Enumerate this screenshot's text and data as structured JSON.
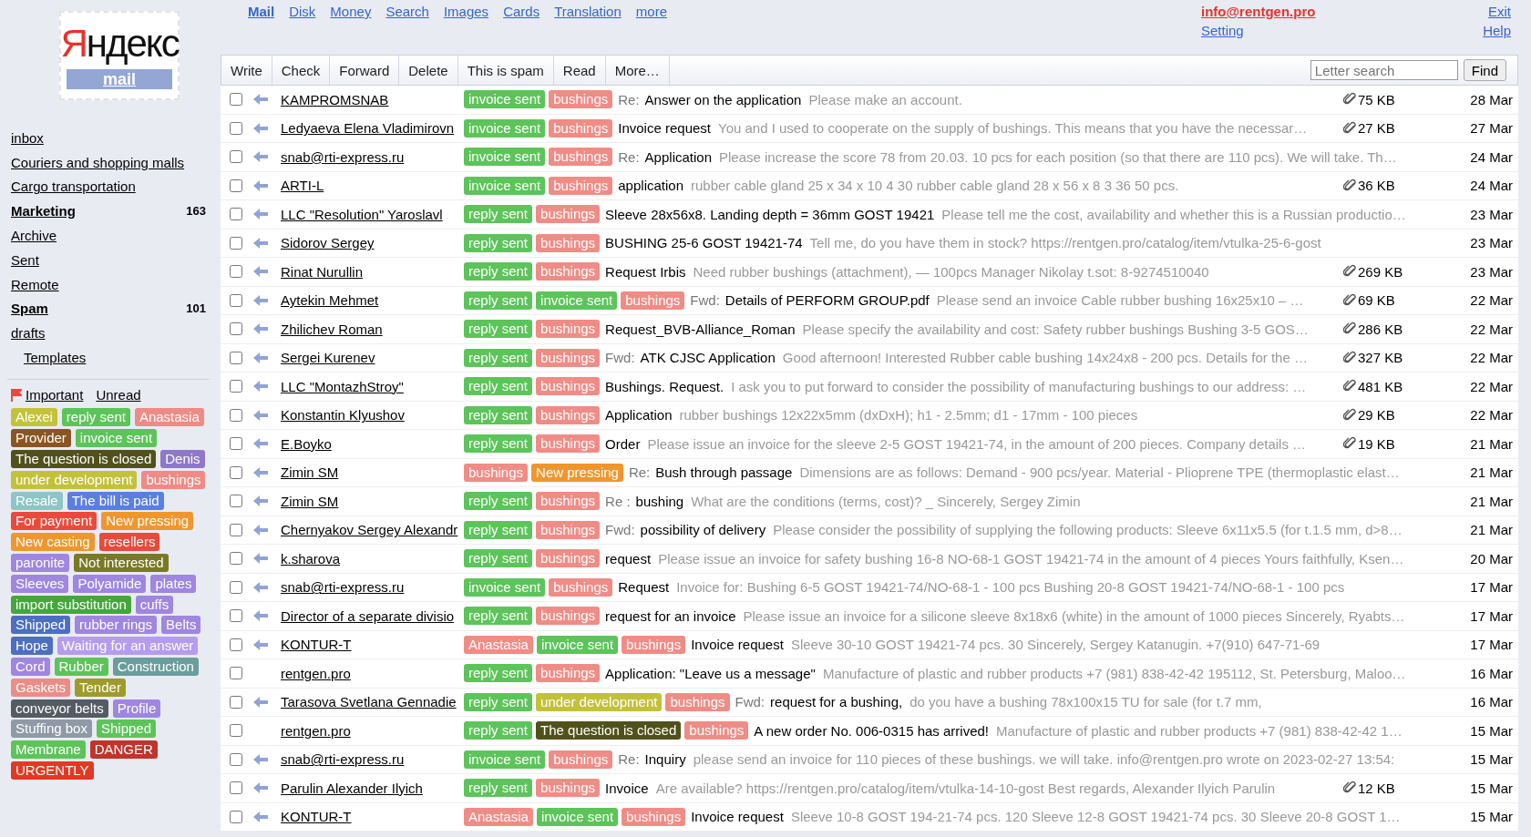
{
  "logo": {
    "wordmark": "Яндекс",
    "product": "mail"
  },
  "nav": [
    {
      "label": "Mail",
      "selected": true
    },
    {
      "label": "Disk",
      "selected": false
    },
    {
      "label": "Money",
      "selected": false
    },
    {
      "label": "Search",
      "selected": false
    },
    {
      "label": "Images",
      "selected": false
    },
    {
      "label": "Cards",
      "selected": false
    },
    {
      "label": "Translation",
      "selected": false
    },
    {
      "label": "more",
      "selected": false
    }
  ],
  "account": {
    "email": "info@rentgen.pro",
    "setting": "Setting",
    "exit": "Exit",
    "help": "Help"
  },
  "folders": [
    {
      "name": "inbox",
      "unread": false
    },
    {
      "name": "Couriers and shopping malls",
      "unread": false
    },
    {
      "name": "Cargo transportation",
      "unread": false
    },
    {
      "name": "Marketing",
      "unread": true,
      "count": "163"
    },
    {
      "name": "Archive",
      "unread": false
    },
    {
      "name": "Sent",
      "unread": false
    },
    {
      "name": "Remote",
      "unread": false
    },
    {
      "name": "Spam",
      "unread": true,
      "count": "101"
    },
    {
      "name": "drafts",
      "unread": false,
      "children": [
        {
          "name": "Templates",
          "unread": false
        }
      ]
    }
  ],
  "filters": [
    "Important",
    "Unread"
  ],
  "label_rows": [
    [
      {
        "label": "Alexei",
        "color": "#c4c23a"
      },
      {
        "label": "reply sent",
        "color": "#5cc45a"
      },
      {
        "label": "Anastasia",
        "color": "#ee8b85"
      }
    ],
    [
      {
        "label": "Provider",
        "color": "#8a5523"
      },
      {
        "label": "invoice sent",
        "color": "#5cc45a"
      }
    ],
    [
      {
        "label": "The question is closed",
        "color": "#51521b"
      },
      {
        "label": "Denis",
        "color": "#8f78c8"
      }
    ],
    [
      {
        "label": "under development",
        "color": "#c3c13a"
      },
      {
        "label": "bushings",
        "color": "#ee8b85"
      }
    ],
    [
      {
        "label": "Resale",
        "color": "#8cc6c6"
      },
      {
        "label": "The bill is paid",
        "color": "#5a7fe0"
      }
    ],
    [
      {
        "label": "For payment",
        "color": "#e84a3c"
      },
      {
        "label": "New pressing",
        "color": "#f0962e"
      }
    ],
    [
      {
        "label": "New casting",
        "color": "#f0962e"
      },
      {
        "label": "resellers",
        "color": "#e84a3c"
      }
    ],
    [
      {
        "label": "paronite",
        "color": "#9f86e0"
      },
      {
        "label": "Not interested",
        "color": "#7a7a24"
      }
    ],
    [
      {
        "label": "Sleeves",
        "color": "#9f86e0"
      },
      {
        "label": "Polyamide",
        "color": "#9f86e0"
      },
      {
        "label": "plates",
        "color": "#9f86e0"
      }
    ],
    [
      {
        "label": "import substitution",
        "color": "#46a63e"
      },
      {
        "label": "cuffs",
        "color": "#9f86e0"
      }
    ],
    [
      {
        "label": "Shipped",
        "color": "#4c6fc2"
      },
      {
        "label": "rubber rings",
        "color": "#9f86e0"
      },
      {
        "label": "Belts",
        "color": "#9f86e0"
      }
    ],
    [
      {
        "label": "Hope",
        "color": "#4c6fc2"
      },
      {
        "label": "Waiting for an answer",
        "color": "#b59cf0"
      }
    ],
    [
      {
        "label": "Cord",
        "color": "#9f86e0"
      },
      {
        "label": "Rubber",
        "color": "#5cc45a"
      },
      {
        "label": "Construction",
        "color": "#6a9e9c"
      }
    ],
    [
      {
        "label": "Gaskets",
        "color": "#ee8b85"
      },
      {
        "label": "Tender",
        "color": "#9e9a2c"
      }
    ],
    [
      {
        "label": "conveyor belts",
        "color": "#555b62"
      },
      {
        "label": "Profile",
        "color": "#9f86e0"
      }
    ],
    [
      {
        "label": "Stuffing box",
        "color": "#8f9aa6"
      },
      {
        "label": "Shipped",
        "color": "#5cc45a"
      }
    ],
    [
      {
        "label": "Membrane",
        "color": "#5cc45a"
      },
      {
        "label": "DANGER",
        "color": "#c0342a"
      }
    ],
    [
      {
        "label": "URGENTLY",
        "color": "#e03a24"
      }
    ]
  ],
  "toolbar": {
    "buttons": [
      "Write",
      "Check",
      "Forward",
      "Delete",
      "This is spam",
      "Read",
      "More…"
    ],
    "search": {
      "placeholder": "Letter search"
    },
    "find": "Find"
  },
  "messages": [
    {
      "checked": false,
      "replied": true,
      "sender": "KAMPROMSNAB",
      "tags": [
        {
          "label": "invoice sent",
          "color": "#5cc45a"
        },
        {
          "label": "bushings",
          "color": "#f08c86"
        }
      ],
      "prefix": "Re:",
      "subject": "Answer on the application",
      "snippet": "Please make an account.",
      "attachment": "75 KB",
      "date": "28 Mar"
    },
    {
      "checked": false,
      "replied": true,
      "sender": "Ledyaeva Elena Vladimirovn",
      "tags": [
        {
          "label": "invoice sent",
          "color": "#5cc45a"
        },
        {
          "label": "bushings",
          "color": "#f08c86"
        }
      ],
      "subject": "Invoice request",
      "snippet": "You and I used to cooperate on the supply of bushings. This means that you have the necessar…",
      "attachment": "27 KB",
      "date": "27 Mar"
    },
    {
      "checked": false,
      "replied": true,
      "sender": "snab@rti-express.ru",
      "tags": [
        {
          "label": "invoice sent",
          "color": "#5cc45a"
        },
        {
          "label": "bushings",
          "color": "#f08c86"
        }
      ],
      "prefix": "Re:",
      "subject": "Application",
      "snippet": "Please increase the score 78 from 20.03. 10 pcs for each position (so that there are 110 pcs). We will take. Th…",
      "date": "24 Mar"
    },
    {
      "checked": false,
      "replied": true,
      "sender": "ARTI-L",
      "tags": [
        {
          "label": "invoice sent",
          "color": "#5cc45a"
        },
        {
          "label": "bushings",
          "color": "#f08c86"
        }
      ],
      "subject": "application",
      "snippet": "rubber cable gland 25 x 34 x 10 4 30 rubber cable gland 28 x 56 x 8 3 36 50 pcs.",
      "attachment": "36 KB",
      "date": "24 Mar"
    },
    {
      "checked": false,
      "replied": true,
      "sender": "LLC \"Resolution\" Yaroslavl",
      "tags": [
        {
          "label": "reply sent",
          "color": "#5cc45a"
        },
        {
          "label": "bushings",
          "color": "#f08c86"
        }
      ],
      "subject": "Sleeve 28x56x8. Landing depth = 36mm GOST 19421",
      "snippet": "Please tell me the cost, availability and whether this is a Russian productio…",
      "date": "23 Mar"
    },
    {
      "checked": false,
      "replied": true,
      "sender": "Sidorov Sergey",
      "tags": [
        {
          "label": "reply sent",
          "color": "#5cc45a"
        },
        {
          "label": "bushings",
          "color": "#f08c86"
        }
      ],
      "subject": "BUSHING 25-6 GOST 19421-74",
      "snippet": "Tell me, do you have them in stock? https://rentgen.pro/catalog/item/vtulka-25-6-gost",
      "date": "23 Mar"
    },
    {
      "checked": false,
      "replied": true,
      "sender": "Rinat Nurullin",
      "tags": [
        {
          "label": "reply sent",
          "color": "#5cc45a"
        },
        {
          "label": "bushings",
          "color": "#f08c86"
        }
      ],
      "subject": "Request Irbis",
      "snippet": "Need rubber bushings (attachment), — 100pcs Manager Nikolay t.sot: 8-9274510040",
      "attachment": "269 KB",
      "date": "23 Mar"
    },
    {
      "checked": false,
      "replied": true,
      "sender": "Aytekin Mehmet",
      "tags": [
        {
          "label": "reply sent",
          "color": "#5cc45a"
        },
        {
          "label": "invoice sent",
          "color": "#5cc45a"
        },
        {
          "label": "bushings",
          "color": "#f08c86"
        }
      ],
      "prefix": "Fwd:",
      "subject": "Details of PERFORM GROUP.pdf",
      "snippet": "Please send an invoice Cable rubber bushing 16x25x10 – …",
      "attachment": "69 KB",
      "date": "22 Mar"
    },
    {
      "checked": false,
      "replied": true,
      "sender": "Zhilichev Roman",
      "tags": [
        {
          "label": "reply sent",
          "color": "#5cc45a"
        },
        {
          "label": "bushings",
          "color": "#f08c86"
        }
      ],
      "subject": "Request_BVB-Alliance_Roman",
      "snippet": "Please specify the availability and cost: Safety rubber bushings Bushing 3-5 GOS…",
      "attachment": "286 KB",
      "date": "22 Mar"
    },
    {
      "checked": false,
      "replied": true,
      "sender": "Sergei Kurenev",
      "tags": [
        {
          "label": "reply sent",
          "color": "#5cc45a"
        },
        {
          "label": "bushings",
          "color": "#f08c86"
        }
      ],
      "prefix": "Fwd:",
      "subject": "ATK CJSC Application",
      "snippet": "Good afternoon! Interested Rubber cable bushing 14x24x8 - 200 pcs. Details for the …",
      "attachment": "327 KB",
      "date": "22 Mar"
    },
    {
      "checked": false,
      "replied": true,
      "sender": "LLC \"MontazhStroy\"",
      "tags": [
        {
          "label": "reply sent",
          "color": "#5cc45a"
        },
        {
          "label": "bushings",
          "color": "#f08c86"
        }
      ],
      "subject": "Bushings. Request.",
      "snippet": "I ask you to put forward to consider the possibility of manufacturing bushings to our address: …",
      "attachment": "481 KB",
      "date": "22 Mar"
    },
    {
      "checked": false,
      "replied": true,
      "sender": "Konstantin Klyushov",
      "tags": [
        {
          "label": "reply sent",
          "color": "#5cc45a"
        },
        {
          "label": "bushings",
          "color": "#f08c86"
        }
      ],
      "subject": "Application",
      "snippet": "rubber bushings 12x22x5mm (dxDxH); h1 - 2.5mm; d1 - 17mm - 100 pieces",
      "attachment": "29 KB",
      "date": "22 Mar"
    },
    {
      "checked": false,
      "replied": true,
      "sender": "E.Boyko",
      "tags": [
        {
          "label": "reply sent",
          "color": "#5cc45a"
        },
        {
          "label": "bushings",
          "color": "#f08c86"
        }
      ],
      "subject": "Order",
      "snippet": "Please issue an invoice for the sleeve 2-5 GOST 19421-74, in the amount of 200 pieces. Company details …",
      "attachment": "19 KB",
      "date": "21 Mar"
    },
    {
      "checked": false,
      "replied": true,
      "sender": "Zimin SM",
      "tags": [
        {
          "label": "bushings",
          "color": "#f08c86"
        },
        {
          "label": "New pressing",
          "color": "#f0962e"
        }
      ],
      "prefix": "Re:",
      "subject": "Bush through passage",
      "snippet": "Dimensions are as follows: Demand - 900 pcs/year. Material - Plioprene TPE (thermoplastic elast…",
      "date": "21 Mar"
    },
    {
      "checked": false,
      "replied": true,
      "sender": "Zimin SM",
      "tags": [
        {
          "label": "reply sent",
          "color": "#5cc45a"
        },
        {
          "label": "bushings",
          "color": "#f08c86"
        }
      ],
      "prefix": "Re :",
      "subject": "bushing",
      "snippet": "What are the conditions (terms, cost)? _ Sincerely, Sergey Zimin",
      "date": "21 Mar"
    },
    {
      "checked": false,
      "replied": true,
      "sender": "Chernyakov Sergey Alexandr",
      "tags": [
        {
          "label": "reply sent",
          "color": "#5cc45a"
        },
        {
          "label": "bushings",
          "color": "#f08c86"
        }
      ],
      "prefix": "Fwd:",
      "subject": "possibility of delivery",
      "snippet": "Please consider the possibility of supplying the following products: Sleeve 6x11x5.5 (for t.1.5 mm, d>8…",
      "date": "21 Mar"
    },
    {
      "checked": false,
      "replied": true,
      "sender": "k.sharova",
      "tags": [
        {
          "label": "reply sent",
          "color": "#5cc45a"
        },
        {
          "label": "bushings",
          "color": "#f08c86"
        }
      ],
      "subject": "request",
      "snippet": "Please issue an invoice for safety bushing 16-8 NO-68-1 GOST 19421-74 in the amount of 4 pieces Yours faithfully, Ksen…",
      "date": "20 Mar"
    },
    {
      "checked": false,
      "replied": true,
      "sender": "snab@rti-express.ru",
      "tags": [
        {
          "label": "invoice sent",
          "color": "#5cc45a"
        },
        {
          "label": "bushings",
          "color": "#f08c86"
        }
      ],
      "subject": "Request",
      "snippet": "Invoice for: Bushing 6-5 GOST 19421-74/NO-68-1 - 100 pcs Bushing 20-8 GOST 19421-74/NO-68-1 - 100 pcs",
      "date": "17 Mar"
    },
    {
      "checked": false,
      "replied": true,
      "sender": "Director of a separate divisio",
      "tags": [
        {
          "label": "reply sent",
          "color": "#5cc45a"
        },
        {
          "label": "bushings",
          "color": "#f08c86"
        }
      ],
      "subject": "request for an invoice",
      "snippet": "Please issue an invoice for a silicone sleeve 8x18x6 (white) in the amount of 1000 pieces Sincerely, Ryabts…",
      "date": "17 Mar"
    },
    {
      "checked": false,
      "replied": true,
      "sender": "KONTUR-T",
      "tags": [
        {
          "label": "Anastasia",
          "color": "#f08c86"
        },
        {
          "label": "invoice sent",
          "color": "#5cc45a"
        },
        {
          "label": "bushings",
          "color": "#f08c86"
        }
      ],
      "subject": "Invoice request",
      "snippet": "Sleeve 30-10 GOST 19421-74 pcs. 30 Sincerely, Sergey Katanugin. +7(910) 647-71-69",
      "date": "17 Mar"
    },
    {
      "checked": false,
      "replied": false,
      "sender": "rentgen.pro",
      "tags": [
        {
          "label": "reply sent",
          "color": "#5cc45a"
        },
        {
          "label": "bushings",
          "color": "#f08c86"
        }
      ],
      "subject": "Application: \"Leave us a message\"",
      "snippet": "Manufacture of plastic and rubber products +7 (981) 838-42-42 195112, St. Petersburg, Maloo…",
      "date": "16 Mar"
    },
    {
      "checked": false,
      "replied": true,
      "sender": "Tarasova Svetlana Gennadie",
      "tags": [
        {
          "label": "reply sent",
          "color": "#5cc45a"
        },
        {
          "label": "under development",
          "color": "#c3c13a"
        },
        {
          "label": "bushings",
          "color": "#f08c86"
        }
      ],
      "prefix": "Fwd:",
      "subject": "request for a bushing,",
      "snippet": "do you have a bushing 78x100x15 TU for sale (for t.7 mm,",
      "date": "16 Mar"
    },
    {
      "checked": false,
      "replied": false,
      "sender": "rentgen.pro",
      "tags": [
        {
          "label": "reply sent",
          "color": "#5cc45a"
        },
        {
          "label": "The question is closed",
          "color": "#51521b"
        },
        {
          "label": "bushings",
          "color": "#f08c86"
        }
      ],
      "subject": "A new order No. 006-0315 has arrived!",
      "snippet": "Manufacture of plastic and rubber products +7 (981) 838-42-42 1…",
      "date": "15 Mar"
    },
    {
      "checked": false,
      "replied": true,
      "sender": "snab@rti-express.ru",
      "tags": [
        {
          "label": "invoice sent",
          "color": "#5cc45a"
        },
        {
          "label": "bushings",
          "color": "#f08c86"
        }
      ],
      "prefix": "Re:",
      "subject": "Inquiry",
      "snippet": "please send an invoice for 110 pieces of these bushings. we will take. info@rentgen.pro wrote on 2023-02-27 13:54:",
      "date": "15 Mar"
    },
    {
      "checked": false,
      "replied": true,
      "sender": "Parulin Alexander Ilyich",
      "tags": [
        {
          "label": "reply sent",
          "color": "#5cc45a"
        },
        {
          "label": "bushings",
          "color": "#f08c86"
        }
      ],
      "subject": "Invoice",
      "snippet": "Are available? https://rentgen.pro/catalog/item/vtulka-14-10-gost Best regards, Alexander Ilyich Parulin",
      "attachment": "12 KB",
      "date": "15 Mar"
    },
    {
      "checked": false,
      "replied": true,
      "sender": "KONTUR-T",
      "tags": [
        {
          "label": "Anastasia",
          "color": "#f08c86"
        },
        {
          "label": "invoice sent",
          "color": "#5cc45a"
        },
        {
          "label": "bushings",
          "color": "#f08c86"
        }
      ],
      "subject": "Invoice request",
      "snippet": "Sleeve 10-8 GOST 194-21-74 pcs. 120 Sleeve 12-8 GOST 19421-74 pcs. 30 Sleeve 20-8 GOST 1…",
      "date": "15 Mar"
    }
  ]
}
